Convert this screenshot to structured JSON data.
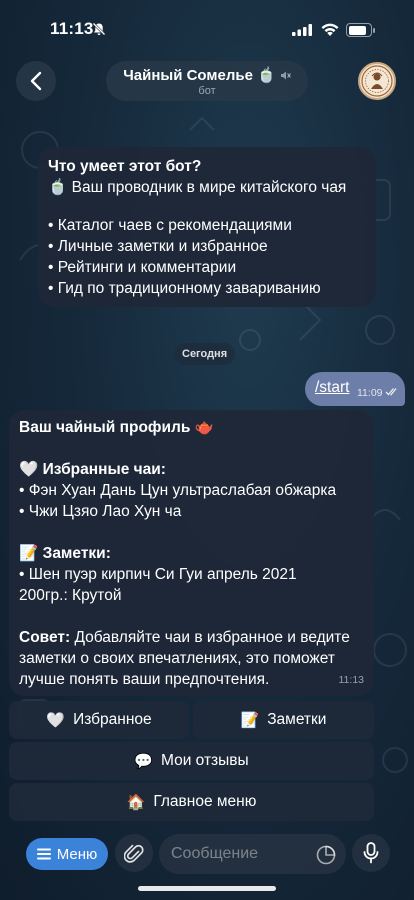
{
  "status_bar": {
    "time": "11:13"
  },
  "header": {
    "title": "Чайный Сомелье 🍵",
    "subtitle": "бот"
  },
  "intro_message": {
    "heading": "Что умеет этот бот?",
    "tagline": "🍵 Ваш проводник в мире китайского чая",
    "features": [
      "• Каталог чаев с рекомендациями",
      "• Личные заметки и избранное",
      "• Рейтинги и комментарии",
      "• Гид по традиционному завариванию"
    ]
  },
  "date_separator": "Сегодня",
  "outgoing_message": {
    "text": "/start",
    "time": "11:09"
  },
  "profile_message": {
    "title": "Ваш чайный профиль 🫖",
    "favorites_heading": "🤍 Избранные чаи:",
    "favorites": [
      "• Фэн Хуан Дань Цун ультраслабая обжарка",
      "• Чжи Цзяо Лао Хун ча"
    ],
    "notes_heading": "📝 Заметки:",
    "notes": [
      "• Шен пуэр кирпич Си Гуи апрель 2021",
      "200гр.: Крутой"
    ],
    "tip_label": "Совет:",
    "tip_lines": [
      " Добавляйте чаи в избранное и ведите",
      "заметки о своих впечатлениях, это поможет",
      "лучше понять ваши предпочтения."
    ],
    "time": "11:13"
  },
  "keyboard": {
    "favorites": {
      "emoji": "🤍",
      "label": "Избранное"
    },
    "notes": {
      "emoji": "📝",
      "label": "Заметки"
    },
    "reviews": {
      "emoji": "💬",
      "label": "Мои отзывы"
    },
    "main_menu": {
      "emoji": "🏠",
      "label": "Главное меню"
    }
  },
  "input_bar": {
    "menu_label": "Меню",
    "placeholder": "Сообщение"
  },
  "colors": {
    "accent": "#3b82d9",
    "outgoing_bubble": "#6d7ea9",
    "incoming_bubble": "#1e2838"
  }
}
